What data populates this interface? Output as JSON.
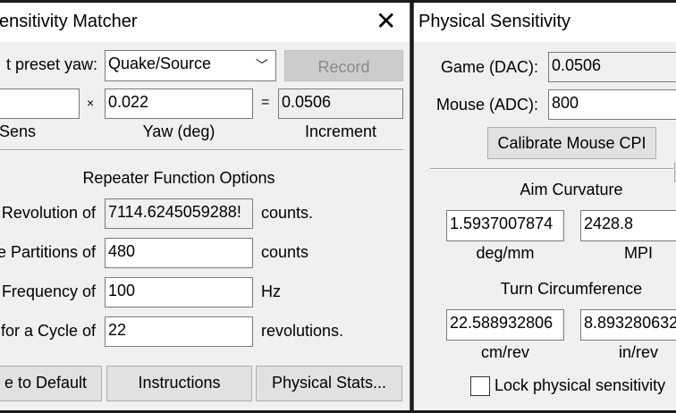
{
  "matcher": {
    "title": "ensitivity Matcher",
    "preset_label": "t preset yaw:",
    "preset_value": "Quake/Source",
    "record": "Record",
    "sens_value": "",
    "times": "×",
    "yaw_value": "0.022",
    "equals": "=",
    "increment_value": "0.0506",
    "sens_label": "Sens",
    "yaw_label": "Yaw (deg)",
    "increment_label": "Increment",
    "repeater_title": "Repeater Function Options",
    "rows": [
      {
        "label": "Revolution of",
        "value": "7114.6245059288!",
        "unit": "counts."
      },
      {
        "label": "e Partitions of",
        "value": "480",
        "unit": "counts"
      },
      {
        "label": "Frequency of",
        "value": "100",
        "unit": "Hz"
      },
      {
        "label": "for a Cycle of",
        "value": "22",
        "unit": "revolutions."
      }
    ],
    "buttons": {
      "default": "e to Default",
      "instructions": "Instructions",
      "physical": "Physical Stats..."
    }
  },
  "physical": {
    "title": "Physical Sensitivity",
    "game_label": "Game (DAC):",
    "game_value": "0.0506",
    "mouse_label": "Mouse (ADC):",
    "mouse_value": "800",
    "calibrate": "Calibrate Mouse CPI",
    "aim_title": "Aim Curvature",
    "deg_mm": "1.5937007874",
    "mpi": "2428.8",
    "deg_mm_label": "deg/mm",
    "mpi_label": "MPI",
    "turn_title": "Turn Circumference",
    "cm_rev": "22.588932806",
    "in_rev": "8.893280632",
    "cm_rev_label": "cm/rev",
    "in_rev_label": "in/rev",
    "lock_label": "Lock physical sensitivity",
    "lock_checked": false
  }
}
